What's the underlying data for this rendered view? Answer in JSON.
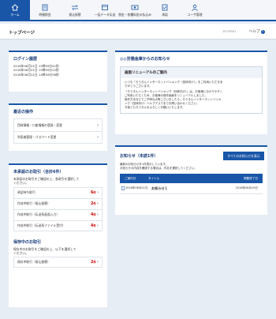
{
  "nav": [
    {
      "label": "ホーム",
      "icon": "home-icon",
      "active": true
    },
    {
      "label": "明細照会",
      "icon": "statement-icon"
    },
    {
      "label": "振込振替",
      "icon": "transfer-icon"
    },
    {
      "label": "一括データ伝送",
      "icon": "data-transmission-icon"
    },
    {
      "label": "税金・各種料金の払込み",
      "icon": "tax-payment-icon"
    },
    {
      "label": "承認",
      "icon": "approval-icon"
    },
    {
      "label": "ユーザ管理",
      "icon": "user-management-icon"
    }
  ],
  "page": {
    "title": "トップページ",
    "id": "BTOP001",
    "help": "ヘルプ"
  },
  "login_history": {
    "title": "ログイン履歴",
    "entries": [
      "2016年06月21日 15時59分41秒",
      "2016年06月21日 15時09分12秒",
      "2016年06月21日 14時49分36秒"
    ]
  },
  "recent_ops": {
    "title": "最近の操作",
    "items": [
      "団体情報・口座情報の登録・変更",
      "利用者管理・パスワード変更"
    ]
  },
  "pending": {
    "title": "未承認のお取引（合計6件）",
    "desc": [
      "未承認のお取引をご確認の上、各取引を選択して",
      "ください。"
    ],
    "items": [
      {
        "label": "承認待ち取引",
        "count": "6",
        "unit": "件"
      },
      {
        "label": "作成中取引（振込振替）",
        "count": "2",
        "unit": "件"
      },
      {
        "label": "作成中取引（伝送系画面入力）",
        "count": "4",
        "unit": "件"
      },
      {
        "label": "作成中取引（伝送系ファイル受付）",
        "count": "4",
        "unit": "件"
      }
    ]
  },
  "saved": {
    "title": "保存中のお取引",
    "desc": [
      "保存中のお取引をご確認の上、以下を選択して",
      "ください。"
    ],
    "items": [
      {
        "label": "保存中取引（振込振替）",
        "count": "2",
        "unit": "件"
      }
    ]
  },
  "bank_notice": {
    "title": "◎◎労働金庫からのお知らせ",
    "box_title": "画面リニューアルのご案内",
    "body": [
      "いつも「ろうきんインターネットバンキング（団体向け）」をご利用いただきあ",
      "りがとうございます。",
      "「ろうきんインターネットバンキング（団体向け）」は、お客様に分かりやすく",
      "ご利用いただくため、お客様の操作画面をリニューアルしました。",
      "操作方法などでご不明な点等ございましたら、ろうきんインターネットバンキ",
      "ング（団体向け）ヘルプデスクまでお問い合わせください。",
      "今後ともろうきんをよろしくお願いいたします。"
    ]
  },
  "notices": {
    "title": "お知らせ（未読1件）",
    "all_button": "すべてのお知らせを表示",
    "desc": [
      "最新のお知らせを1件表示しています。",
      "お知らせの内容を確認する場合は、件名を選択してください。"
    ],
    "columns": {
      "date": "ご案内日",
      "title": "タイトル",
      "deadline": "掲載終了日"
    },
    "rows": [
      {
        "date": "2016年06月21日",
        "title": "お知らせ１",
        "deadline": "2016年06月19日"
      }
    ]
  }
}
